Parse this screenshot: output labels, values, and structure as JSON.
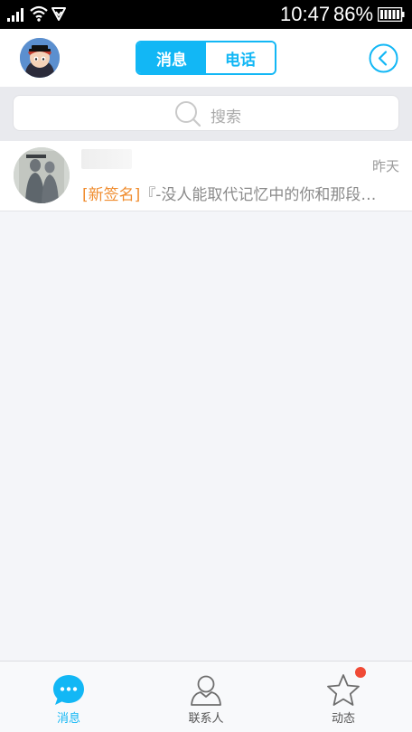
{
  "status_bar": {
    "time": "10:47",
    "battery": "86%",
    "icons": [
      "signal-icon",
      "wifi-icon",
      "vpn-shield-icon",
      "battery-icon"
    ]
  },
  "header": {
    "tabs": [
      {
        "label": "消息",
        "active": true
      },
      {
        "label": "电话",
        "active": false
      }
    ],
    "accent_color": "#12b7f5"
  },
  "search": {
    "placeholder": "搜索"
  },
  "conversations": [
    {
      "time": "昨天",
      "tag": "[新签名]",
      "preview": "『-没人能取代记忆中的你和那段…"
    }
  ],
  "tabbar": {
    "items": [
      {
        "label": "消息",
        "icon": "chat-bubble-icon",
        "active": true
      },
      {
        "label": "联系人",
        "icon": "contacts-icon",
        "active": false
      },
      {
        "label": "动态",
        "icon": "star-icon",
        "active": false,
        "badge": true
      }
    ],
    "badge_color": "#f04a36"
  }
}
